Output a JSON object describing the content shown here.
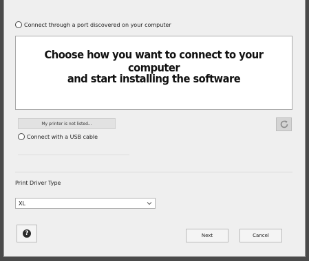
{
  "connection_options": {
    "network_label": "Connect through a port discovered on your computer",
    "usb_label": "Connect with a USB cable"
  },
  "port_list": {
    "caption_line1": "Choose how you want to connect to your computer",
    "caption_line2": "and start installing the software"
  },
  "not_listed_label": "My printer is not listed...",
  "refresh_icon": "refresh-icon",
  "driver": {
    "label": "Print Driver Type",
    "selected": "XL"
  },
  "footer": {
    "help_glyph": "?",
    "next_label": "Next",
    "cancel_label": "Cancel"
  }
}
